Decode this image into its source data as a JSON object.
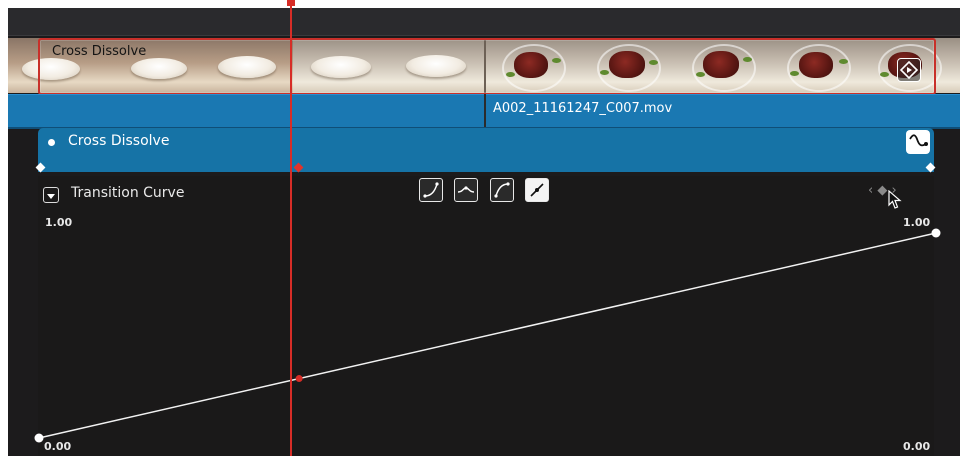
{
  "transition": {
    "name": "Cross Dissolve"
  },
  "clip": {
    "filename": "A002_11161247_C007.mov"
  },
  "inspector": {
    "effect_name": "Cross Dissolve",
    "curve_section_label": "Transition Curve",
    "curve_modes": [
      "ease-in-icon",
      "ease-in-out-icon",
      "ease-out-icon",
      "linear-icon"
    ],
    "active_mode": "linear-icon",
    "keyframe_nav": "‹ ◆ ›"
  },
  "graph": {
    "y_max_label_left": "1.00",
    "y_max_label_right": "1.00",
    "y_min_label_left": "0.00",
    "y_min_label_right": "0.00",
    "curve_start_value": 0.0,
    "curve_end_value": 1.0,
    "playhead_fraction": 0.29
  },
  "colors": {
    "accent_blue": "#1673a6",
    "clip_blue": "#1a78b2",
    "playhead_red": "#d72d27"
  }
}
